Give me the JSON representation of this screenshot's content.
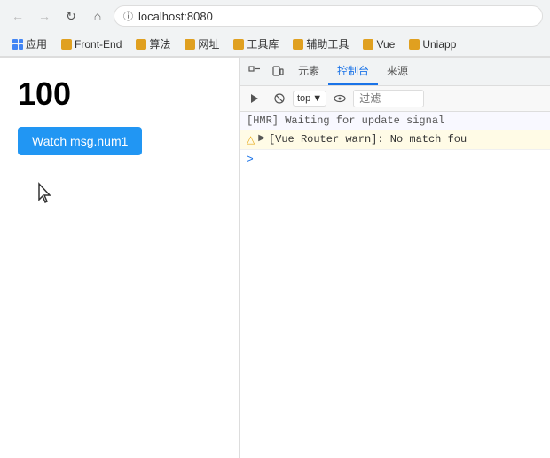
{
  "browser": {
    "back_disabled": true,
    "forward_disabled": true,
    "url": "localhost:8080",
    "lock_icon": "🔒"
  },
  "bookmarks": [
    {
      "label": "应用",
      "color": "grid"
    },
    {
      "label": "Front-End",
      "color": "yellow"
    },
    {
      "label": "算法",
      "color": "yellow"
    },
    {
      "label": "网址",
      "color": "yellow"
    },
    {
      "label": "工具库",
      "color": "yellow"
    },
    {
      "label": "辅助工具",
      "color": "yellow"
    },
    {
      "label": "Vue",
      "color": "yellow"
    },
    {
      "label": "Uniapp",
      "color": "yellow"
    }
  ],
  "devtools": {
    "tabs": [
      "元素",
      "控制台",
      "来源"
    ],
    "active_tab": "控制台",
    "toolbar": {
      "top_label": "top",
      "filter_placeholder": "过滤"
    },
    "console_lines": [
      {
        "type": "info",
        "text": "[HMR] Waiting for update signal "
      },
      {
        "type": "warn",
        "text": "[Vue Router warn]: No match fou"
      },
      {
        "type": "prompt",
        "text": ">"
      }
    ]
  },
  "webpage": {
    "number": "100",
    "button_label": "Watch msg.num1"
  }
}
